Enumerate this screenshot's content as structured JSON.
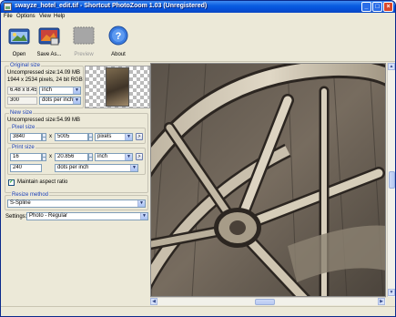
{
  "window": {
    "title": "swayze_hotel_edit.tif - Shortcut PhotoZoom 1.03 (Unregistered)",
    "minimize_glyph": "_",
    "maximize_glyph": "□",
    "close_glyph": "×"
  },
  "menu": [
    "File",
    "Options",
    "View",
    "Help"
  ],
  "toolbar": {
    "open_label": "Open",
    "save_label": "Save As...",
    "preview_label": "Preview",
    "about_label": "About"
  },
  "original": {
    "legend": "Original size",
    "uncompressed": "Uncompressed size:14.09 MB",
    "pixels": "1944 x 2534 pixels, 24 bit RGB",
    "width": "6.48 x 8.45",
    "unit": "inch",
    "resolution": "300",
    "res_unit": "dots per inch"
  },
  "new_size": {
    "legend": "New size",
    "uncompressed": "Uncompressed size:54.99 MB",
    "pixel_legend": "Pixel size",
    "pixel_width": "3840",
    "x_sep": "x",
    "pixel_height": "5005",
    "pixel_unit": "pixels",
    "print_legend": "Print size",
    "print_width": "16",
    "print_height": "20.856",
    "print_unit": "inch",
    "resolution": "240",
    "res_unit": "dots per inch",
    "aspect_label": "Maintain aspect ratio",
    "aspect_checked": "✓",
    "more_btn": ">"
  },
  "resize": {
    "legend": "Resize method",
    "method": "S-Spline",
    "settings_label": "Settings:",
    "settings_value": "Photo - Regular"
  },
  "icons": {
    "combo_arrow": "▼",
    "up_arrow": "▲",
    "down_arrow": "▼",
    "left_arrow": "◀",
    "right_arrow": "▶"
  }
}
